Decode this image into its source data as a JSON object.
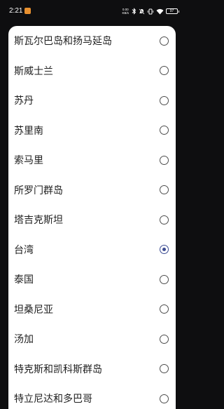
{
  "status_bar": {
    "time": "2:21",
    "net_speed_value": "0.00",
    "net_speed_unit": "KB/s",
    "battery_level": "97"
  },
  "dialog": {
    "options": [
      {
        "label": "斯瓦尔巴岛和扬马延岛",
        "selected": false
      },
      {
        "label": "斯威士兰",
        "selected": false
      },
      {
        "label": "苏丹",
        "selected": false
      },
      {
        "label": "苏里南",
        "selected": false
      },
      {
        "label": "索马里",
        "selected": false
      },
      {
        "label": "所罗门群岛",
        "selected": false
      },
      {
        "label": "塔吉克斯坦",
        "selected": false
      },
      {
        "label": "台湾",
        "selected": true
      },
      {
        "label": "泰国",
        "selected": false
      },
      {
        "label": "坦桑尼亚",
        "selected": false
      },
      {
        "label": "汤加",
        "selected": false
      },
      {
        "label": "特克斯和凯科斯群岛",
        "selected": false
      },
      {
        "label": "特立尼达和多巴哥",
        "selected": false
      }
    ]
  },
  "colors": {
    "radio_selected": "#3c4c92",
    "radio_unselected": "#4d4d4d",
    "backdrop": "#0e0e10"
  }
}
